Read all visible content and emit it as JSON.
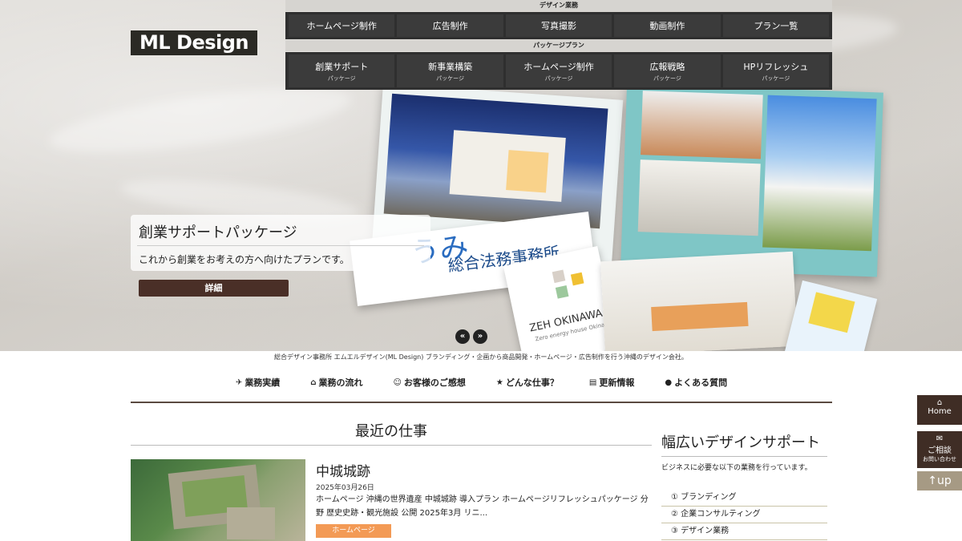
{
  "brand": {
    "logo": "ML Design"
  },
  "header": {
    "design_label": "デザイン業務",
    "design_menu": [
      {
        "label": "ホームページ制作"
      },
      {
        "label": "広告制作"
      },
      {
        "label": "写真撮影"
      },
      {
        "label": "動画制作"
      },
      {
        "label": "プラン一覧"
      }
    ],
    "package_label": "パッケージプラン",
    "package_menu": [
      {
        "label": "創業サポート",
        "sub": "パッケージ"
      },
      {
        "label": "新事業構築",
        "sub": "パッケージ"
      },
      {
        "label": "ホームページ制作",
        "sub": "パッケージ"
      },
      {
        "label": "広報戦略",
        "sub": "パッケージ"
      },
      {
        "label": "HPリフレッシュ",
        "sub": "パッケージ"
      }
    ]
  },
  "hero": {
    "title": "創業サポートパッケージ",
    "text": "これから創業をお考えの方へ向けたプランです。",
    "button": "詳細",
    "prev": "«",
    "next": "»",
    "mock_law_prefix": "うみ",
    "mock_law": "総合法務事務所",
    "mock_zeh": "ZEH OKINAWA",
    "mock_zeh_sub": "Zero energy house Okinawa"
  },
  "intro": "総合デザイン事務所 エムエルデザイン(ML Design) ブランディング・企画から商品開発・ホームページ・広告制作を行う沖縄のデザイン会社。",
  "subnav": [
    {
      "icon": "pin-icon",
      "glyph": "✈",
      "label": "業務実績"
    },
    {
      "icon": "home-icon",
      "glyph": "⌂",
      "label": "業務の流れ"
    },
    {
      "icon": "user-icon",
      "glyph": "☺",
      "label": "お客様のご感想"
    },
    {
      "icon": "star-icon",
      "glyph": "★",
      "label": "どんな仕事？"
    },
    {
      "icon": "news-icon",
      "glyph": "▤",
      "label": "更新情報"
    },
    {
      "icon": "chat-icon",
      "glyph": "●",
      "label": "よくある質問"
    }
  ],
  "recent": {
    "title": "最近の仕事",
    "item": {
      "title": "中城城跡",
      "date": "2025年03月26日",
      "desc": "ホームページ 沖縄の世界遺産 中城城跡 導入プラン ホームページリフレッシュパッケージ 分野 歴史史跡・観光施設 公開 2025年3月 リニ...",
      "tag": "ホームページ"
    }
  },
  "sidebar": {
    "title": "幅広いデザインサポート",
    "text": "ビジネスに必要な以下の業務を行っています。",
    "items": [
      {
        "label": "① ブランディング"
      },
      {
        "label": "② 企業コンサルティング"
      },
      {
        "label": "③ デザイン業務"
      }
    ]
  },
  "float": {
    "home": "Home",
    "home_icon": "⌂",
    "consult": "ご相談",
    "consult_sub": "お問い合わせ",
    "consult_icon": "✉",
    "up": "↑up"
  },
  "colors": {
    "brown": "#3f2d25",
    "orange": "#f39a55",
    "menu": "#2f2f2f"
  }
}
